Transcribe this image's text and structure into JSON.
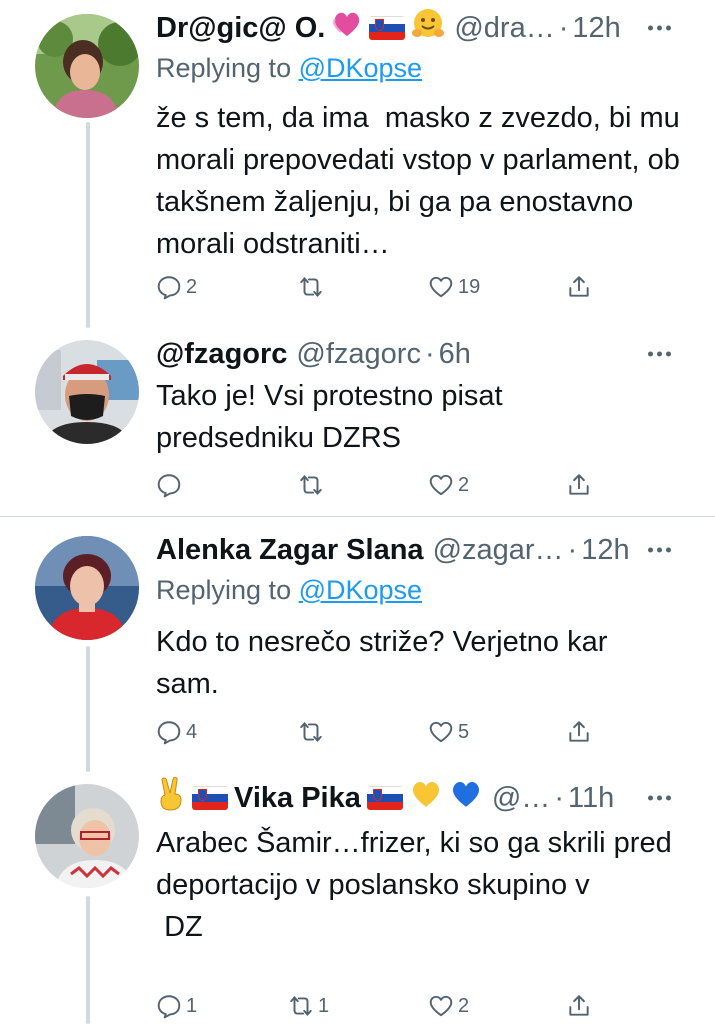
{
  "tweets": [
    {
      "display_name": "Dr@gic@ O.",
      "name_emojis": [
        "heart-emoji",
        "slovenia-flag-icon",
        "hug-emoji"
      ],
      "handle": "@dra…",
      "dot": "·",
      "time": "12h",
      "replying_prefix": "Replying to ",
      "replying_to": "@DKopse",
      "text": "že s tem, da ima  masko z zvezdo, bi mu morali prepovedati vstop v parlament, ob takšnem žaljenju, bi ga pa enostavno morali odstraniti…",
      "replies": "2",
      "retweets": "",
      "likes": "19"
    },
    {
      "display_name": "@fzagorc",
      "handle": "@fzagorc",
      "dot": "·",
      "time": "6h",
      "text": "Tako je! Vsi protestno pisat\npredsedniku DZRS",
      "replies": "",
      "retweets": "",
      "likes": "2"
    },
    {
      "display_name": "Alenka Zagar Slana",
      "handle": "@zagar…",
      "dot": "·",
      "time": "12h",
      "replying_prefix": "Replying to ",
      "replying_to": "@DKopse",
      "text": "Kdo to nesrečo striže? Verjetno kar sam.",
      "replies": "4",
      "retweets": "",
      "likes": "5"
    },
    {
      "display_name": "Vika Pika",
      "name_emojis_before": [
        "victory-hand-emoji",
        "slovenia-flag-icon"
      ],
      "name_emojis_after": [
        "slovenia-flag-icon",
        "yellow-heart-emoji",
        "blue-heart-emoji"
      ],
      "handle": "@…",
      "dot": "·",
      "time": "11h",
      "text": "Arabec Šamir…frizer, ki so ga skrili pred deportacijo v poslansko skupino v\n DZ",
      "replies": "1",
      "retweets": "1",
      "likes": "2"
    }
  ],
  "colors": {
    "text": "#0f1419",
    "secondary": "#536471",
    "link": "#1d9bf0",
    "thread_line": "#cfd9de"
  }
}
